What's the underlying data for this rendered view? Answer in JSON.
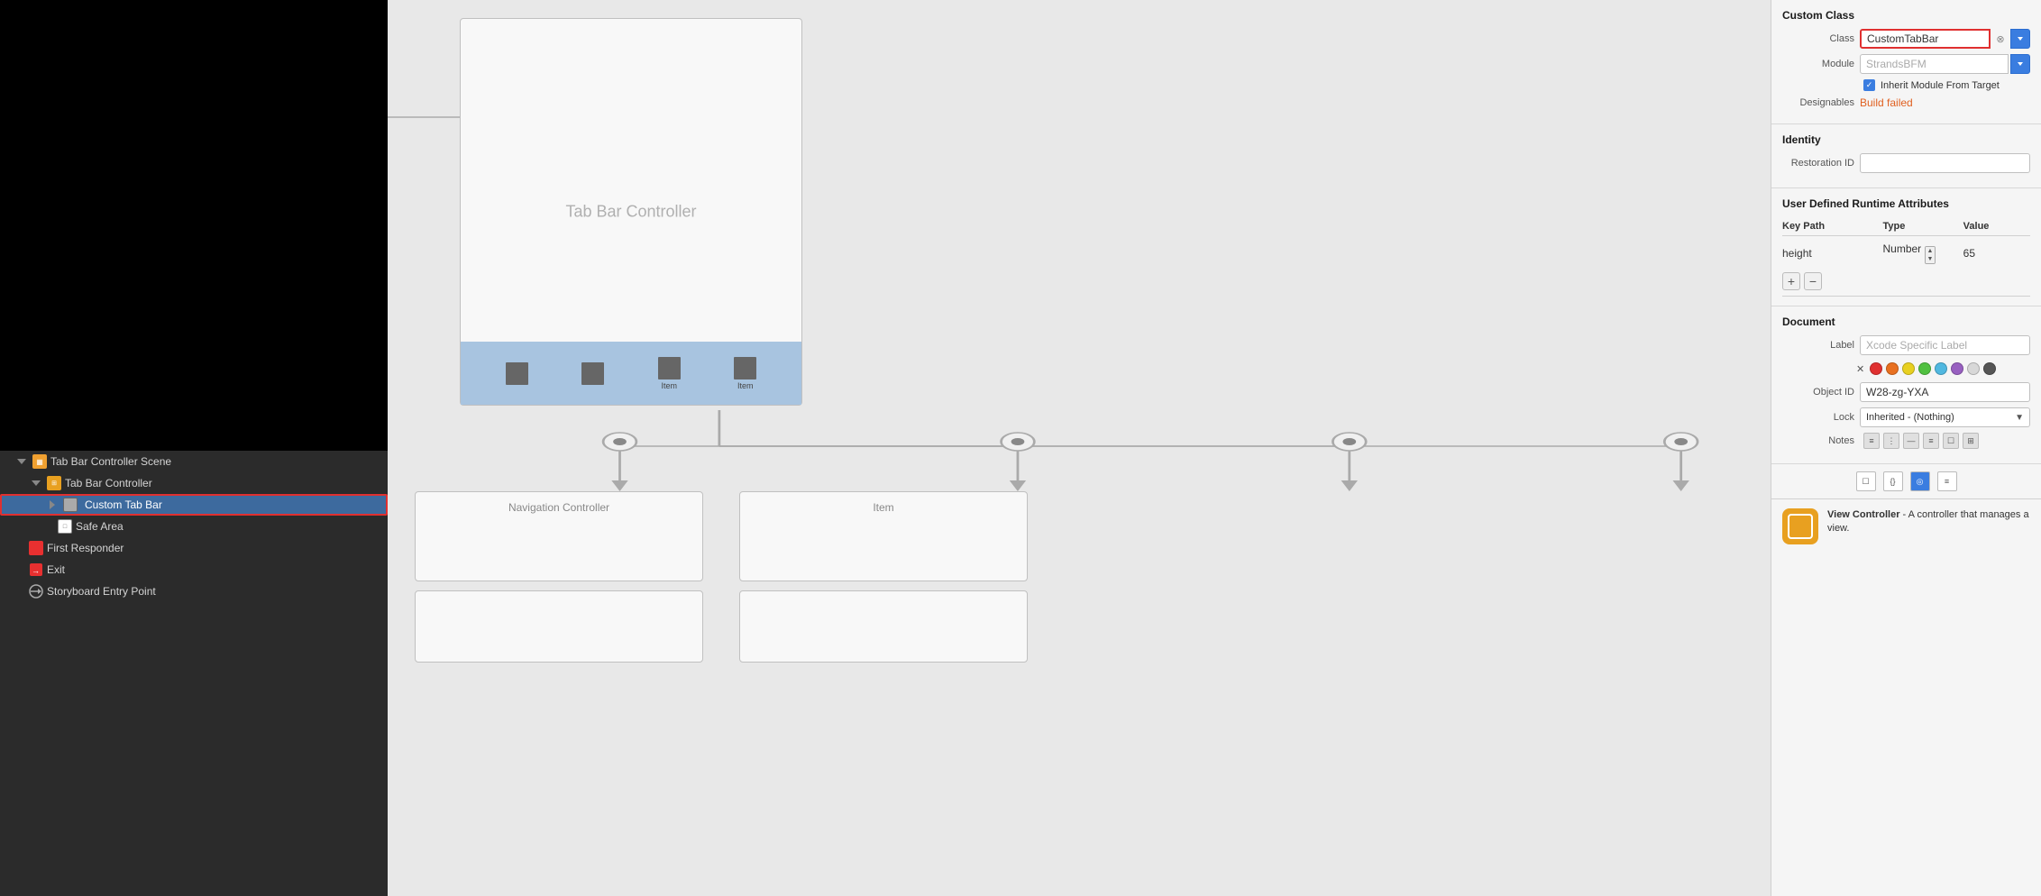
{
  "leftPanel": {
    "outlineItems": [
      {
        "id": "scene",
        "label": "Tab Bar Controller Scene",
        "indent": 0,
        "icon": "scene",
        "expanded": true
      },
      {
        "id": "tabbar",
        "label": "Tab Bar Controller",
        "indent": 1,
        "icon": "tabbar",
        "expanded": true
      },
      {
        "id": "customtabbar",
        "label": "Custom Tab Bar",
        "indent": 2,
        "icon": "customtabbar",
        "selected": true,
        "hasRedBorder": true
      },
      {
        "id": "safearea",
        "label": "Safe Area",
        "indent": 3,
        "icon": "safearea"
      },
      {
        "id": "firstresponder",
        "label": "First Responder",
        "indent": 1,
        "icon": "firstresponder"
      },
      {
        "id": "exit",
        "label": "Exit",
        "indent": 1,
        "icon": "exit"
      },
      {
        "id": "entrypoint",
        "label": "Storyboard Entry Point",
        "indent": 1,
        "icon": "entrypoint"
      }
    ]
  },
  "canvas": {
    "tabBarController": {
      "label": "Tab Bar Controller",
      "tabItems": [
        "",
        "",
        "",
        ""
      ],
      "itemLabels": [
        "",
        "",
        "Item",
        "Item"
      ]
    },
    "subScenes": [
      {
        "label": "Navigation Controller"
      },
      {
        "label": "Item"
      }
    ]
  },
  "rightPanel": {
    "customClass": {
      "title": "Custom Class",
      "classLabel": "Class",
      "classValue": "CustomTabBar",
      "moduleLabel": "Module",
      "modulePlaceholder": "StrandsBFM",
      "inheritLabel": "Inherit Module From Target",
      "designablesLabel": "Designables",
      "designablesValue": "Build failed"
    },
    "identity": {
      "title": "Identity",
      "restorationIdLabel": "Restoration ID",
      "restorationIdValue": ""
    },
    "userDefined": {
      "title": "User Defined Runtime Attributes",
      "columns": [
        "Key Path",
        "Type",
        "Value"
      ],
      "rows": [
        {
          "keyPath": "height",
          "type": "Number",
          "value": "65"
        }
      ]
    },
    "document": {
      "title": "Document",
      "labelLabel": "Label",
      "labelPlaceholder": "Xcode Specific Label",
      "colors": [
        "#e03030",
        "#e87020",
        "#e8d020",
        "#50c040",
        "#50b8e0",
        "#9860c0",
        "#d8d8d8",
        "#555"
      ],
      "objectIdLabel": "Object ID",
      "objectIdValue": "W28-zg-YXA",
      "lockLabel": "Lock",
      "lockValue": "Inherited - (Nothing)",
      "notesLabel": "Notes"
    },
    "viewController": {
      "name": "View Controller",
      "description": "A controller that manages a view."
    }
  }
}
